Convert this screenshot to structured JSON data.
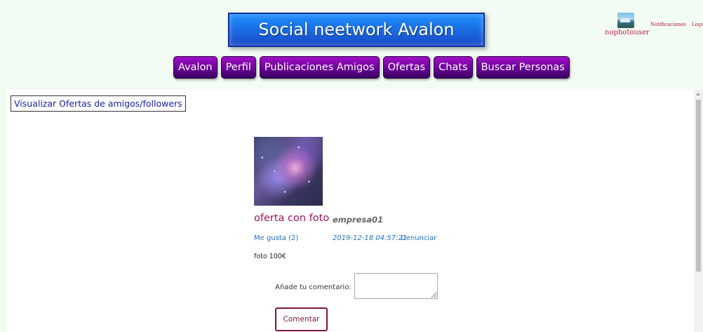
{
  "header": {
    "title": "Social neetwork Avalon",
    "nav": [
      {
        "label": "Avalon"
      },
      {
        "label": "Perfil"
      },
      {
        "label": "Publicaciones Amigos"
      },
      {
        "label": "Ofertas"
      },
      {
        "label": "Chats"
      },
      {
        "label": "Buscar Personas"
      }
    ],
    "user": {
      "name": "nophotouser"
    },
    "links": {
      "notifications": "Notificaciones",
      "logout": "Logout"
    }
  },
  "main": {
    "view_offers_label": "Visualizar Ofertas de amigos/followers",
    "offer": {
      "title": "oferta con foto",
      "company": "empresa01",
      "likes": "Me gusta (2)",
      "date": "2019-12-18 04:57:21",
      "report": "Denunciar",
      "description": "foto 100€"
    },
    "comment": {
      "label": "Añade tu comentario:",
      "value": "",
      "button": "Comentar"
    }
  },
  "colors": {
    "title_bg": "#1e90ff",
    "nav_bg": "#6a0096",
    "accent": "#a0145a",
    "link": "#2070c8",
    "page_bg": "#f3fcf3"
  }
}
